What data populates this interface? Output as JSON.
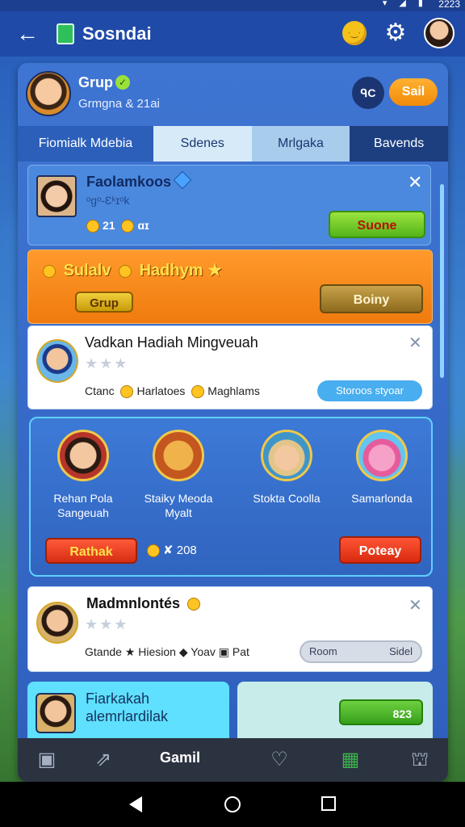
{
  "status": {
    "time": "2223",
    "icons": "▾ ◢ ▮"
  },
  "appbar": {
    "title": "Sosndai"
  },
  "group": {
    "name": "Grup",
    "subtitle": "Grmgna & 21ai",
    "oc_label": "ᑫC",
    "sail_label": "Sail"
  },
  "tabs": [
    {
      "label": "Fiomialk Mdebia"
    },
    {
      "label": "Sdenes"
    },
    {
      "label": "Mrlgaka"
    },
    {
      "label": "Bavends"
    }
  ],
  "card1": {
    "title": "Faolamkoos",
    "subtitle": "ᵒgᵒ-Ɛᵏɪᵒk",
    "coins_a": "21",
    "coins_b": "ɑɪ",
    "button": "Suone"
  },
  "card2": {
    "title": "Sulalv",
    "title2": "Hadhym",
    "badge": "Grup",
    "button": "Boiny"
  },
  "card3": {
    "title": "Vadkan Hadiah Mingveuah",
    "stars": "★★★",
    "stat_a": "Ctanc",
    "stat_b": "Harlatoes",
    "stat_c": "Maghlams",
    "button": "Storoos styoar"
  },
  "card4": {
    "items": [
      {
        "name": "Rehan Pola Sangeuah"
      },
      {
        "name": "Staiky Meoda Myalt"
      },
      {
        "name": "Stokta Coolla"
      },
      {
        "name": "Samarlonda"
      }
    ],
    "left_button": "Rathak",
    "count": "208",
    "right_button": "Poteay"
  },
  "card5": {
    "title": "Madmnlontés",
    "stars": "★★★",
    "stat_a": "Gtande",
    "stat_b": "Hiesion",
    "stat_c": "Yoav",
    "stat_d": "Pat",
    "field_left": "Room",
    "field_right": "Sidel"
  },
  "card6": {
    "title": "Fiarkakah alemrlardilak"
  },
  "card7": {
    "value": "823"
  },
  "bottomnav": {
    "label": "Gamil"
  }
}
